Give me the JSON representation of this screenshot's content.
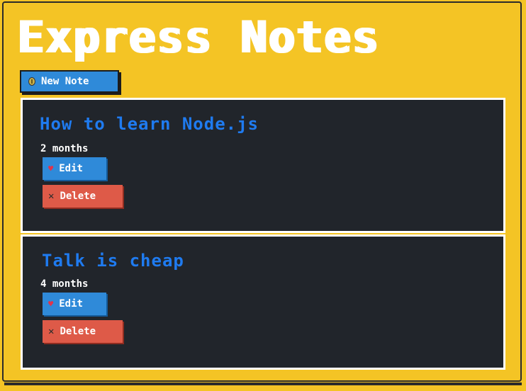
{
  "app": {
    "title": "Express Notes",
    "new_note_label": "New Note"
  },
  "notes": [
    {
      "title": "How to learn Node.js",
      "age": "2 months",
      "edit_label": "Edit",
      "delete_label": "Delete"
    },
    {
      "title": "Talk is cheap",
      "age": "4 months",
      "edit_label": "Edit",
      "delete_label": "Delete"
    }
  ],
  "icons": {
    "new_note": "coin-icon",
    "edit": "heart-icon",
    "delete": "x-icon"
  },
  "colors": {
    "background": "#f4c425",
    "card": "#21252b",
    "title_link": "#1f7bf0",
    "primary_button": "#2f8ad9",
    "danger_button": "#de5a48"
  }
}
